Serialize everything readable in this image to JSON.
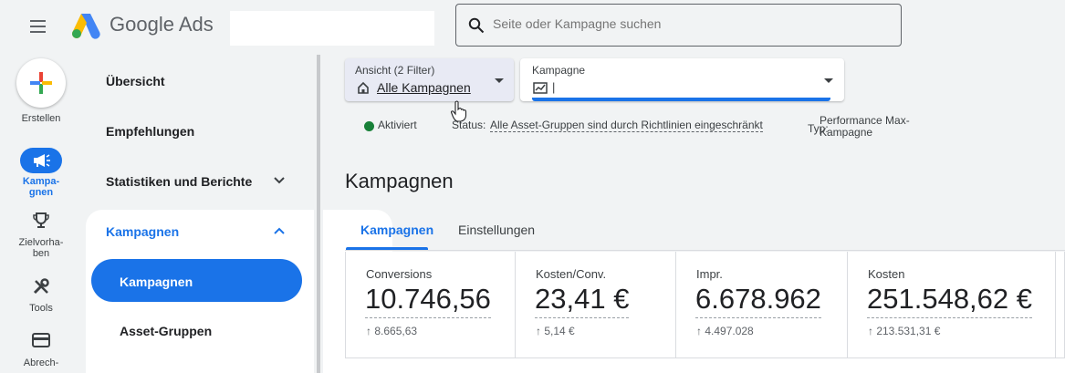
{
  "header": {
    "product_name": "Google Ads",
    "search_placeholder": "Seite oder Kampagne suchen"
  },
  "rail": {
    "create_label": "Erstellen",
    "items": [
      {
        "label": "Kampa-\ngnen",
        "icon": "megaphone-icon",
        "active": true
      },
      {
        "label": "Zielvorha-\nben",
        "icon": "trophy-icon"
      },
      {
        "label": "Tools",
        "icon": "tools-icon"
      },
      {
        "label": "Abrech-",
        "icon": "credit-card-icon"
      }
    ]
  },
  "sidenav": {
    "overview": "Übersicht",
    "recommendations": "Empfehlungen",
    "reports": "Statistiken und Berichte",
    "campaigns_group": "Kampagnen",
    "campaigns_item": "Kampagnen",
    "asset_groups": "Asset-Gruppen"
  },
  "filters": {
    "view_label": "Ansicht (2 Filter)",
    "view_value": "Alle Kampagnen",
    "campaign_label": "Kampagne",
    "campaign_value": "|"
  },
  "status": {
    "state": "Aktiviert",
    "status_label": "Status:",
    "status_value": "Alle Asset-Gruppen sind durch Richtlinien eingeschränkt",
    "type_label": "Typ:",
    "type_value_line1": "Performance Max-",
    "type_value_line2": "Kampagne"
  },
  "page": {
    "title": "Kampagnen",
    "tabs": [
      {
        "label": "Kampagnen",
        "active": true
      },
      {
        "label": "Einstellungen",
        "active": false
      }
    ]
  },
  "metrics": [
    {
      "label": "Conversions",
      "value": "10.746,56",
      "previous": "↑ 8.665,63"
    },
    {
      "label": "Kosten/Conv.",
      "value": "23,41 €",
      "previous": "↑ 5,14 €"
    },
    {
      "label": "Impr.",
      "value": "6.678.962",
      "previous": "↑ 4.497.028"
    },
    {
      "label": "Kosten",
      "value": "251.548,62 €",
      "previous": "↑ 213.531,31 €"
    }
  ],
  "colors": {
    "accent": "#1a73e8",
    "status_green": "#188038",
    "background": "#f1f3f4"
  }
}
